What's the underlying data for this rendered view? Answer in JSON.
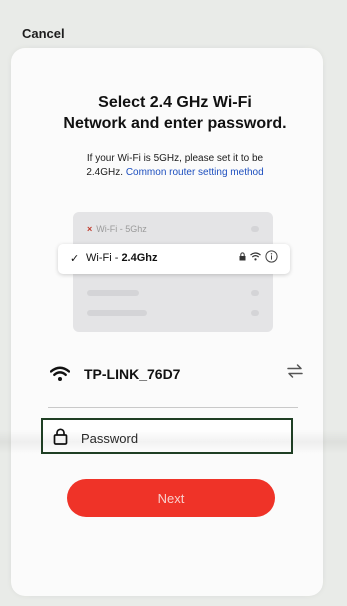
{
  "header": {
    "cancel_label": "Cancel"
  },
  "main": {
    "title_line1": "Select 2.4 GHz Wi-Fi",
    "title_line2": "Network and enter password.",
    "subtitle_line1": "If your Wi-Fi is 5GHz, please set it to be",
    "subtitle_prefix": "2.4GHz.",
    "subtitle_link": "Common router setting method"
  },
  "illustration": {
    "row_5g_label": "Wi-Fi - 5Ghz",
    "row_24_prefix": "Wi-Fi - ",
    "row_24_bold": "2.4Ghz"
  },
  "network": {
    "name": "TP-LINK_76D7"
  },
  "password": {
    "placeholder": "Password",
    "value": ""
  },
  "actions": {
    "next_label": "Next"
  },
  "colors": {
    "accent": "#ef3328",
    "link": "#1d4fbf",
    "field_border": "#1f3f24"
  },
  "icons": [
    "wifi-icon",
    "swap-icon",
    "lock-icon",
    "check-icon",
    "info-icon",
    "signal-icon"
  ]
}
